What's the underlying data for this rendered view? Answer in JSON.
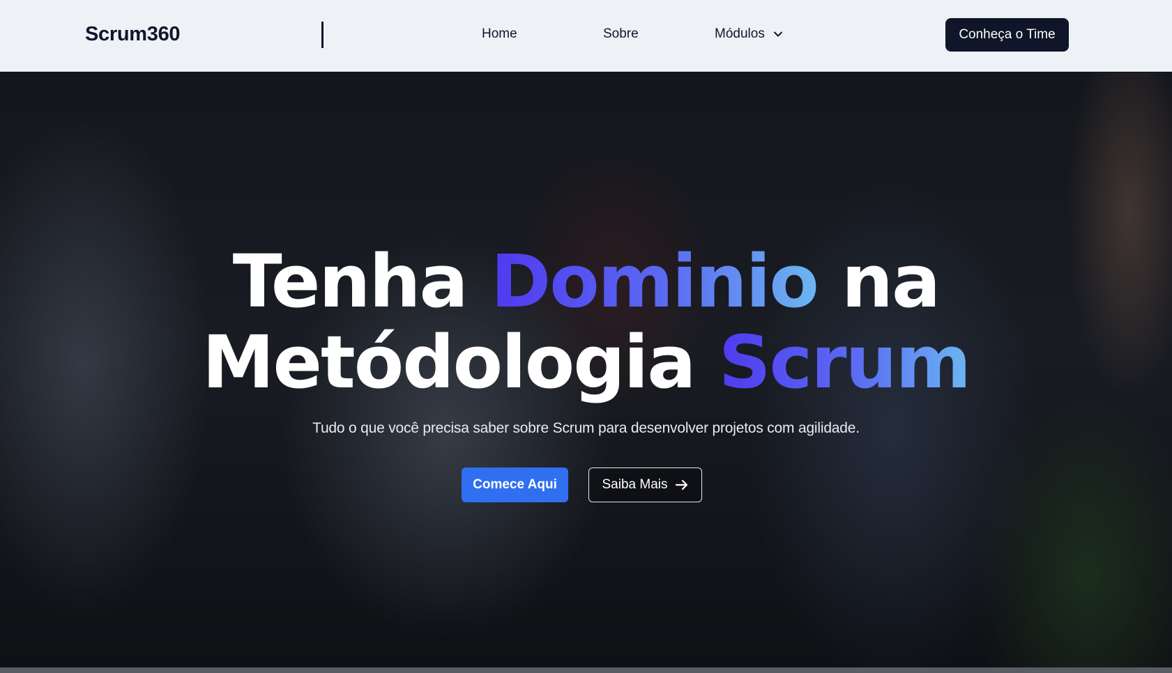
{
  "header": {
    "logo": "Scrum360",
    "nav": {
      "home": "Home",
      "sobre": "Sobre",
      "modulos": "Módulos"
    },
    "cta_label": "Conheça o Time"
  },
  "hero": {
    "title": {
      "line1_part1": "Tenha ",
      "line1_highlight": "Dominio",
      "line1_part2": " na",
      "line2_part1": "Metódologia ",
      "line2_highlight": "Scrum"
    },
    "subtitle": "Tudo o que você precisa saber sobre Scrum para desenvolver projetos com agilidade.",
    "primary_button": "Comece Aqui",
    "secondary_button": "Saiba Mais"
  },
  "icons": {
    "dropdown": "chevron-down-icon",
    "secondary_button": "arrow-right-icon"
  },
  "colors": {
    "header_bg": "#eef2f7",
    "navy": "#0f1629",
    "primary_blue": "#2f6ff0",
    "gradient_start": "#4f3af0",
    "gradient_end": "#6cb6f2"
  }
}
